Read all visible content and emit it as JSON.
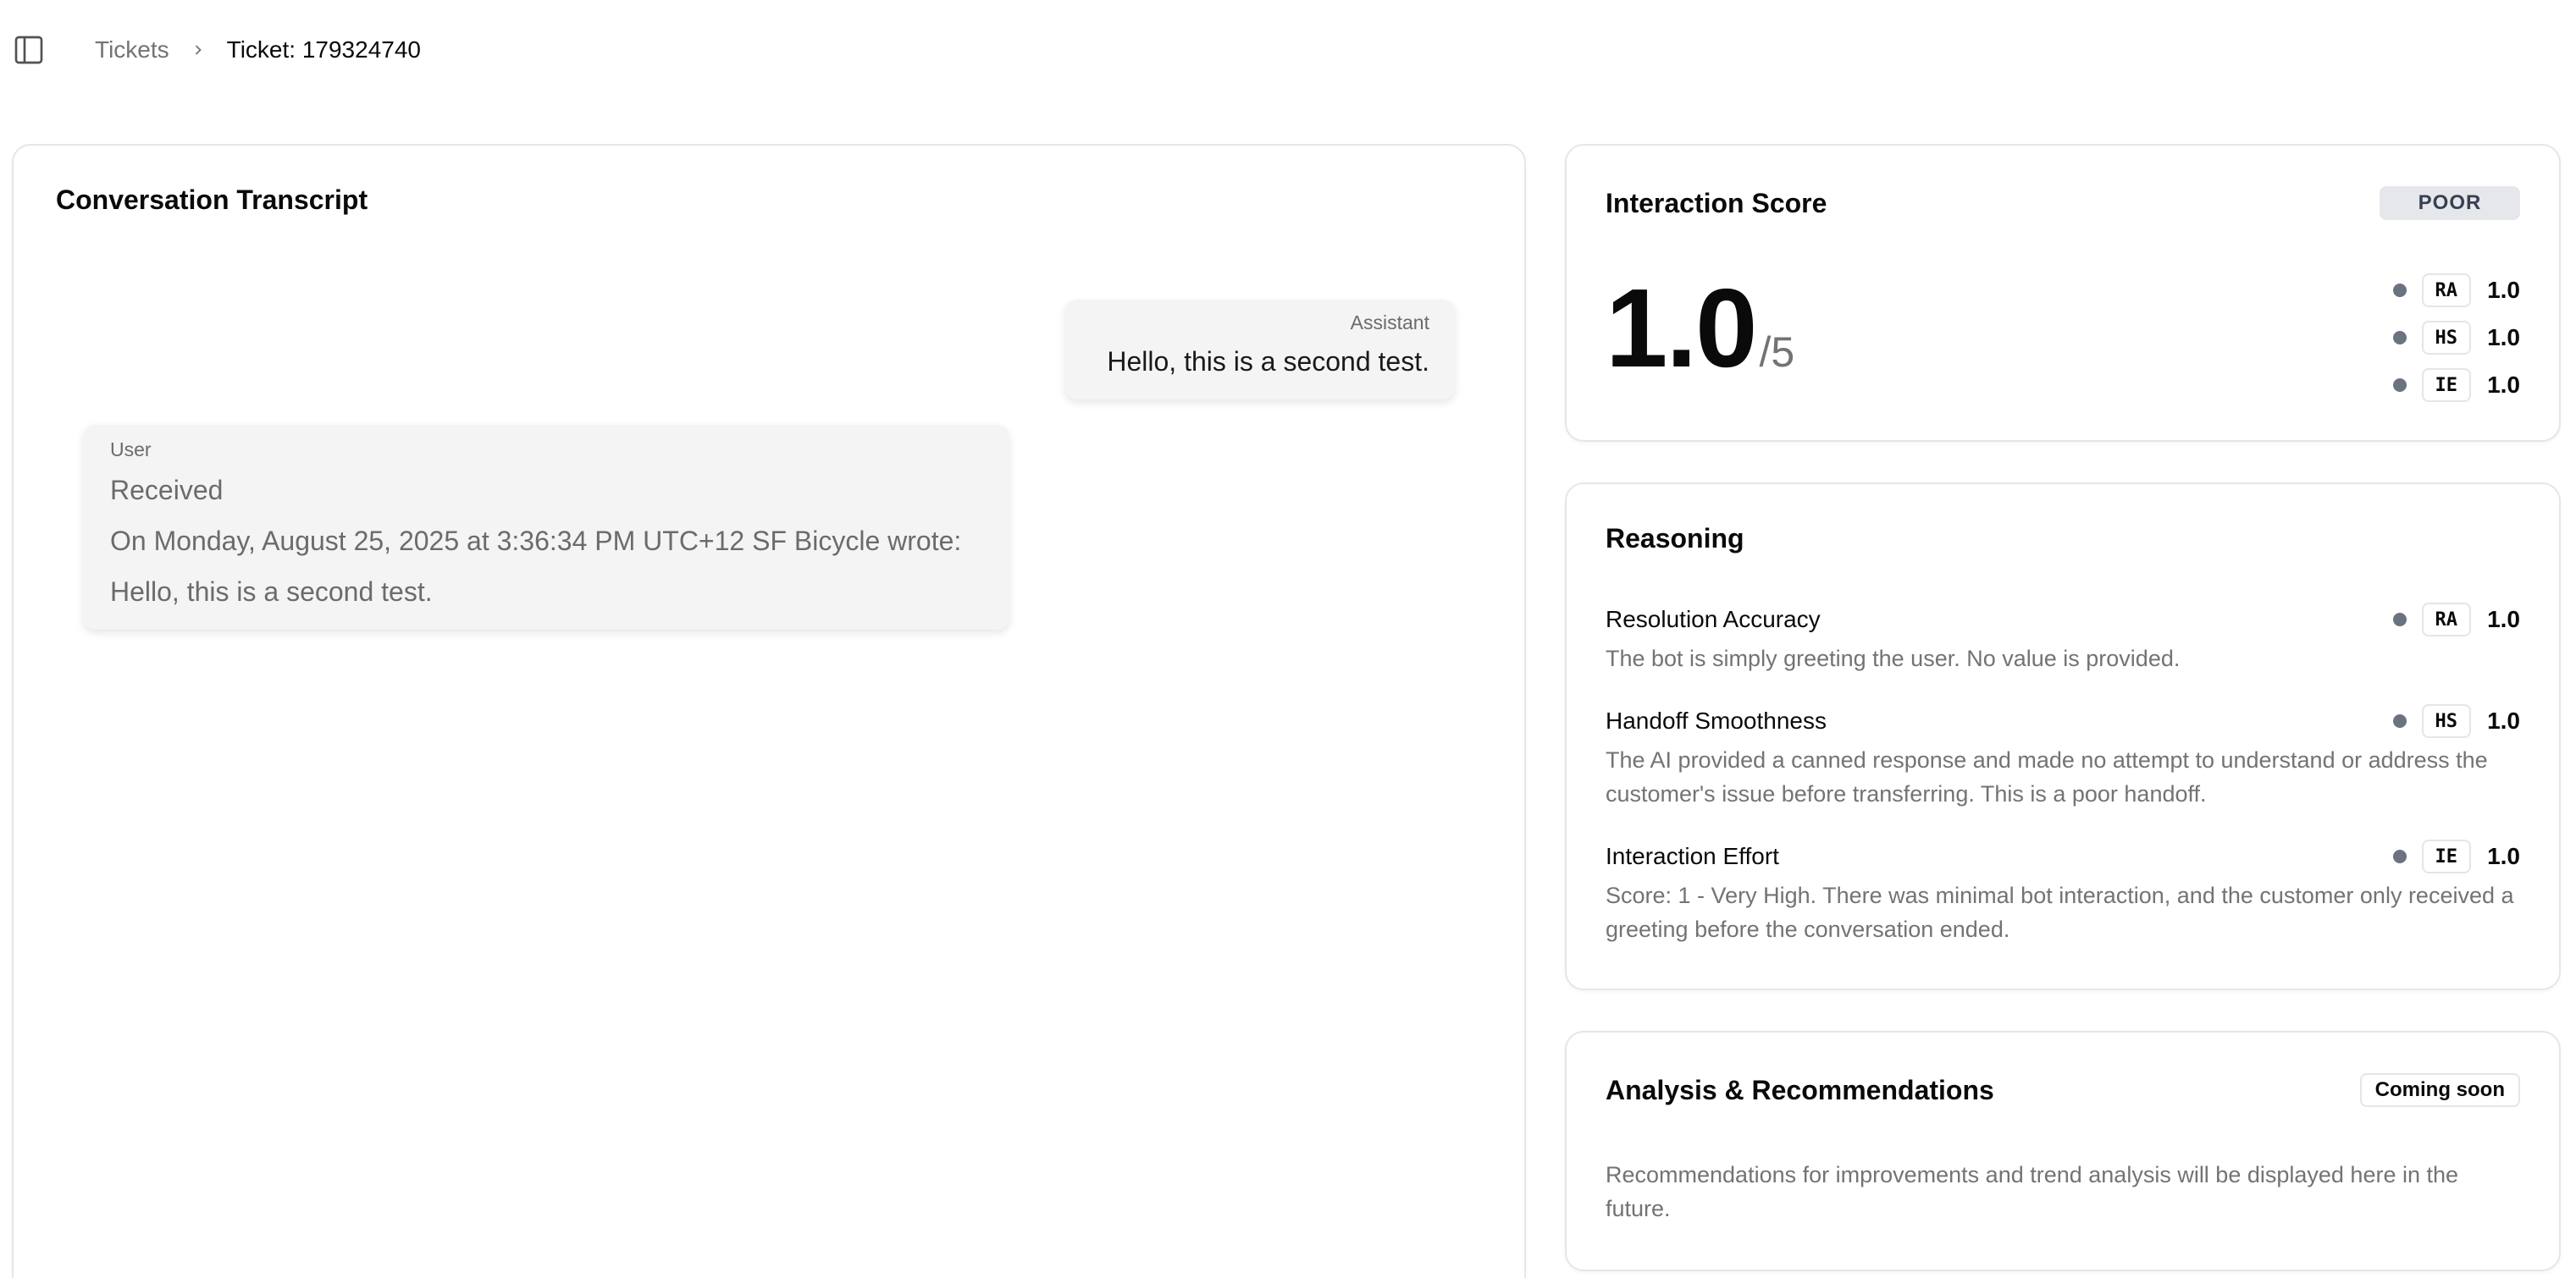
{
  "breadcrumb": {
    "root": "Tickets",
    "current": "Ticket: 179324740"
  },
  "transcript": {
    "title": "Conversation Transcript",
    "messages": [
      {
        "role": "Assistant",
        "lines": [
          "Hello, this is a second test."
        ]
      },
      {
        "role": "User",
        "lines": [
          "Received",
          "On Monday, August 25, 2025 at 3:36:34 PM UTC+12 SF Bicycle wrote:",
          "Hello, this is a second test."
        ]
      }
    ]
  },
  "score": {
    "title": "Interaction Score",
    "badge": "POOR",
    "value": "1.0",
    "out_of": "/5",
    "metrics": [
      {
        "code": "RA",
        "value": "1.0"
      },
      {
        "code": "HS",
        "value": "1.0"
      },
      {
        "code": "IE",
        "value": "1.0"
      }
    ]
  },
  "reasoning": {
    "title": "Reasoning",
    "items": [
      {
        "name": "Resolution Accuracy",
        "code": "RA",
        "value": "1.0",
        "text": "The bot is simply greeting the user. No value is provided."
      },
      {
        "name": "Handoff Smoothness",
        "code": "HS",
        "value": "1.0",
        "text": "The AI provided a canned response and made no attempt to understand or address the customer's issue before transferring. This is a poor handoff."
      },
      {
        "name": "Interaction Effort",
        "code": "IE",
        "value": "1.0",
        "text": "Score: 1 - Very High. There was minimal bot interaction, and the customer only received a greeting before the conversation ended."
      }
    ]
  },
  "analysis": {
    "title": "Analysis & Recommendations",
    "badge": "Coming soon",
    "text": "Recommendations for improvements and trend analysis will be displayed here in the future."
  },
  "icons": {
    "sidebar_toggle": "sidebar-toggle-icon",
    "separator": "chevron-right-icon",
    "metric_dot": "dot-icon"
  },
  "colors": {
    "poor_badge_bg": "#e5e7eb",
    "dot": "#6b7280",
    "muted_text": "#737373",
    "bubble_bg": "#f4f4f4"
  }
}
